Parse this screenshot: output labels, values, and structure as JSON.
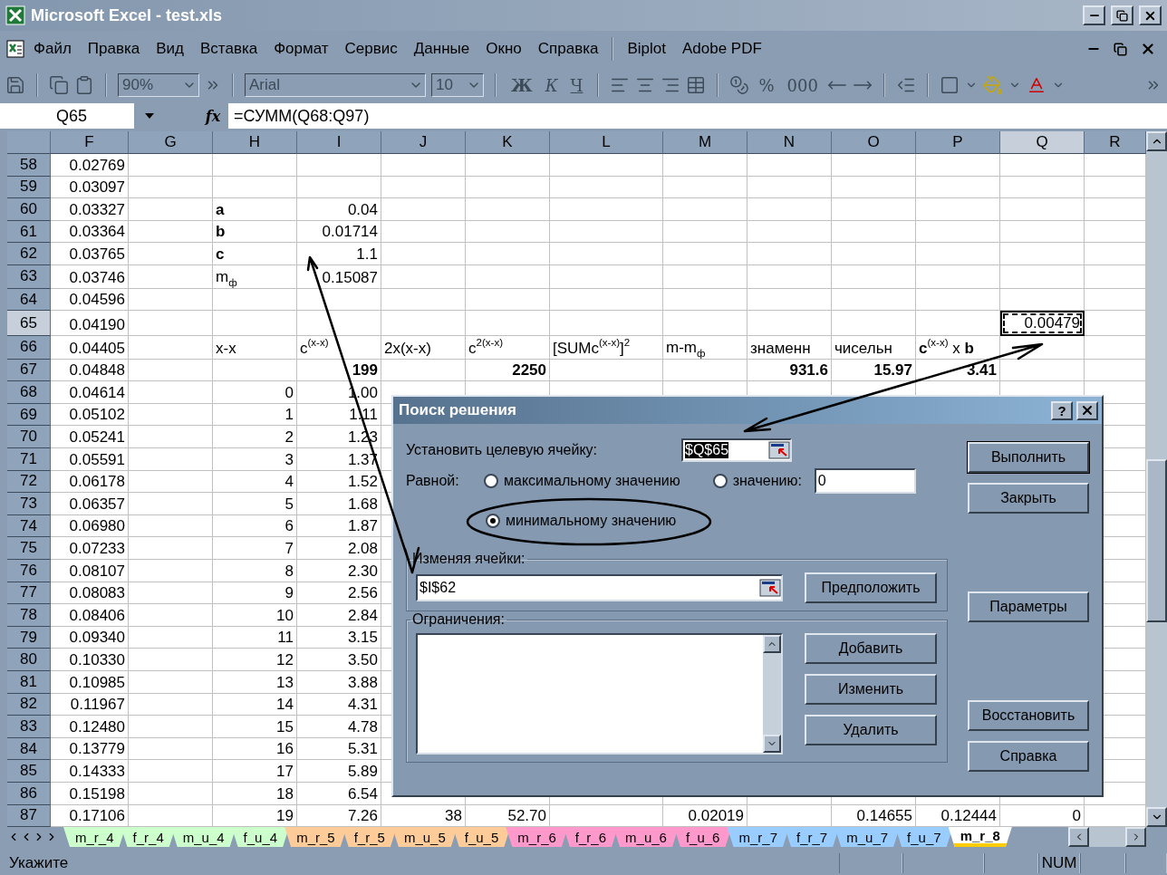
{
  "window": {
    "title": "Microsoft Excel - test.xls"
  },
  "menu": {
    "groups": [
      [
        "Файл",
        "Правка",
        "Вид",
        "Вставка",
        "Формат",
        "Сервис",
        "Данные",
        "Окно",
        "Справка"
      ],
      [
        "Biplot",
        "Adobe PDF"
      ]
    ]
  },
  "toolbar": {
    "disabled": true,
    "zoom": "90%",
    "font": "Arial",
    "font_size": "10",
    "style_buttons": [
      "Ж",
      "К",
      "Ч"
    ],
    "number_buttons": [
      "%",
      "000"
    ]
  },
  "formula_bar": {
    "name_box": "Q65",
    "fx_label": "fx",
    "formula": "=СУММ(Q68:Q97)"
  },
  "sheet": {
    "columns": [
      {
        "label": "F",
        "selected": false
      },
      {
        "label": "G",
        "selected": false
      },
      {
        "label": "H",
        "selected": false
      },
      {
        "label": "I",
        "selected": false
      },
      {
        "label": "J",
        "selected": false
      },
      {
        "label": "K",
        "selected": false
      },
      {
        "label": "L",
        "selected": false
      },
      {
        "label": "M",
        "selected": false
      },
      {
        "label": "N",
        "selected": false
      },
      {
        "label": "O",
        "selected": false
      },
      {
        "label": "P",
        "selected": false
      },
      {
        "label": "Q",
        "selected": true
      },
      {
        "label": "R",
        "selected": false
      }
    ],
    "rows": [
      {
        "num": "58",
        "selected": false,
        "cells": [
          "0.02769"
        ]
      },
      {
        "num": "59",
        "selected": false,
        "cells": [
          "0.03097"
        ]
      },
      {
        "num": "60",
        "selected": false,
        "cells": [
          "0.03327",
          null,
          {
            "text": "a",
            "bold": true,
            "label": true
          },
          "0.04"
        ]
      },
      {
        "num": "61",
        "selected": false,
        "cells": [
          "0.03364",
          null,
          {
            "text": "b",
            "bold": true,
            "label": true
          },
          "0.01714"
        ]
      },
      {
        "num": "62",
        "selected": false,
        "cells": [
          "0.03765",
          null,
          {
            "text": "c",
            "bold": true,
            "label": true
          },
          "1.1"
        ]
      },
      {
        "num": "63",
        "selected": false,
        "cells": [
          "0.03746",
          null,
          {
            "text": "m$_{ф}$",
            "label": true
          },
          "0.15087"
        ]
      },
      {
        "num": "64",
        "selected": false,
        "cells": [
          "0.04596"
        ]
      },
      {
        "num": "65",
        "selected": true,
        "cells": [
          "0.04190",
          null,
          null,
          null,
          null,
          null,
          null,
          null,
          null,
          null,
          null,
          {
            "text": "0.00479",
            "selected": true
          }
        ]
      },
      {
        "num": "66",
        "selected": false,
        "cells": [
          "0.04405",
          null,
          {
            "text": "x-x",
            "label": true
          },
          {
            "text": "c$^{(x-x)}$",
            "label": true
          },
          {
            "text": "2x(x-x)",
            "label": true
          },
          {
            "text": "c$^{2(x-x)}$",
            "label": true
          },
          {
            "text": "[SUMc$^{(x-x)}$]$^{2}$",
            "label": true
          },
          {
            "text": "m-m$_{ф}$",
            "label": true
          },
          {
            "text": "знаменн",
            "label": true
          },
          {
            "text": "чисельн",
            "label": true
          },
          {
            "text": "**c**$^{(x-x)}$ x **b**",
            "label": true
          }
        ]
      },
      {
        "num": "67",
        "selected": false,
        "cells": [
          "0.04848",
          null,
          null,
          {
            "text": "199",
            "bold": true
          },
          null,
          {
            "text": "2250",
            "bold": true
          },
          null,
          null,
          {
            "text": "931.6",
            "bold": true
          },
          {
            "text": "15.97",
            "bold": true
          },
          {
            "text": "3.41",
            "bold": true
          }
        ]
      },
      {
        "num": "68",
        "selected": false,
        "cells": [
          "0.04614",
          null,
          "0",
          "1.00"
        ]
      },
      {
        "num": "69",
        "selected": false,
        "cells": [
          "0.05102",
          null,
          "1",
          "1.11"
        ]
      },
      {
        "num": "70",
        "selected": false,
        "cells": [
          "0.05241",
          null,
          "2",
          "1.23"
        ]
      },
      {
        "num": "71",
        "selected": false,
        "cells": [
          "0.05591",
          null,
          "3",
          "1.37"
        ]
      },
      {
        "num": "72",
        "selected": false,
        "cells": [
          "0.06178",
          null,
          "4",
          "1.52"
        ]
      },
      {
        "num": "73",
        "selected": false,
        "cells": [
          "0.06357",
          null,
          "5",
          "1.68"
        ]
      },
      {
        "num": "74",
        "selected": false,
        "cells": [
          "0.06980",
          null,
          "6",
          "1.87"
        ]
      },
      {
        "num": "75",
        "selected": false,
        "cells": [
          "0.07233",
          null,
          "7",
          "2.08"
        ]
      },
      {
        "num": "76",
        "selected": false,
        "cells": [
          "0.08107",
          null,
          "8",
          "2.30"
        ]
      },
      {
        "num": "77",
        "selected": false,
        "cells": [
          "0.08083",
          null,
          "9",
          "2.56"
        ]
      },
      {
        "num": "78",
        "selected": false,
        "cells": [
          "0.08406",
          null,
          "10",
          "2.84"
        ]
      },
      {
        "num": "79",
        "selected": false,
        "cells": [
          "0.09340",
          null,
          "11",
          "3.15"
        ]
      },
      {
        "num": "80",
        "selected": false,
        "cells": [
          "0.10330",
          null,
          "12",
          "3.50"
        ]
      },
      {
        "num": "81",
        "selected": false,
        "cells": [
          "0.10985",
          null,
          "13",
          "3.88"
        ]
      },
      {
        "num": "82",
        "selected": false,
        "cells": [
          "0.11967",
          null,
          "14",
          "4.31"
        ]
      },
      {
        "num": "83",
        "selected": false,
        "cells": [
          "0.12480",
          null,
          "15",
          "4.78"
        ]
      },
      {
        "num": "84",
        "selected": false,
        "cells": [
          "0.13779",
          null,
          "16",
          "5.31"
        ]
      },
      {
        "num": "85",
        "selected": false,
        "cells": [
          "0.14333",
          null,
          "17",
          "5.89"
        ]
      },
      {
        "num": "86",
        "selected": false,
        "cells": [
          "0.15198",
          null,
          "18",
          "6.54"
        ]
      },
      {
        "num": "87",
        "selected": false,
        "cells": [
          "0.17106",
          null,
          "19",
          "7.26",
          "38",
          "52.70",
          null,
          "0.02019",
          null,
          "0.14655",
          "0.12444",
          "0"
        ]
      }
    ]
  },
  "dialog": {
    "title": "Поиск решения",
    "help": "?",
    "target_label": "Установить целевую ячейку:",
    "target_value": "$Q$65",
    "equal_label": "Равной:",
    "options": [
      {
        "label": "максимальному значению",
        "selected": false
      },
      {
        "label": "значению:",
        "selected": false
      },
      {
        "label": "минимальному значению",
        "selected": true
      }
    ],
    "value_field": "0",
    "changing_label": "Изменяя ячейки:",
    "changing_value": "$I$62",
    "guess_button": "Предположить",
    "constraints_label": "Ограничения:",
    "constraint_buttons": [
      "Добавить",
      "Изменить",
      "Удалить"
    ],
    "button_groups": [
      [
        {
          "label": "Выполнить",
          "default": true
        },
        {
          "label": "Закрыть",
          "default": false
        }
      ],
      [
        {
          "label": "Параметры",
          "default": false
        }
      ],
      [
        {
          "label": "Восстановить",
          "default": false
        },
        {
          "label": "Справка",
          "default": false
        }
      ]
    ]
  },
  "sheet_tabs": [
    {
      "label": "m_r_4",
      "color": "#ccffcc",
      "selected": false
    },
    {
      "label": "f_r_4",
      "color": "#ccffcc",
      "selected": false
    },
    {
      "label": "m_u_4",
      "color": "#ccffcc",
      "selected": false
    },
    {
      "label": "f_u_4",
      "color": "#ccffcc",
      "selected": false
    },
    {
      "label": "m_r_5",
      "color": "#ffcc99",
      "selected": false
    },
    {
      "label": "f_r_5",
      "color": "#ffcc99",
      "selected": false
    },
    {
      "label": "m_u_5",
      "color": "#ffcc99",
      "selected": false
    },
    {
      "label": "f_u_5",
      "color": "#ffcc99",
      "selected": false
    },
    {
      "label": "m_r_6",
      "color": "#ff99cc",
      "selected": false
    },
    {
      "label": "f_r_6",
      "color": "#ff99cc",
      "selected": false
    },
    {
      "label": "m_u_6",
      "color": "#ff99cc",
      "selected": false
    },
    {
      "label": "f_u_6",
      "color": "#ff99cc",
      "selected": false
    },
    {
      "label": "m_r_7",
      "color": "#99ccff",
      "selected": false
    },
    {
      "label": "f_r_7",
      "color": "#99ccff",
      "selected": false
    },
    {
      "label": "m_u_7",
      "color": "#99ccff",
      "selected": false
    },
    {
      "label": "f_u_7",
      "color": "#99ccff",
      "selected": false
    },
    {
      "label": "m_r_8",
      "color": "#ffcc00",
      "selected": true
    }
  ],
  "status_bar": {
    "message": "Укажите",
    "indicators": [
      "NUM"
    ]
  }
}
